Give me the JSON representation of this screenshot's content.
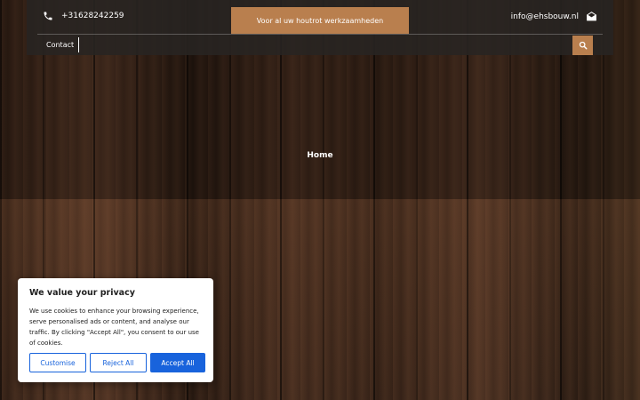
{
  "header": {
    "phone": "+31628242259",
    "tagline": "Voor al uw houtrot werkzaamheden",
    "email": "info@ehsbouw.nl",
    "nav": {
      "contact_label": "Contact"
    },
    "icons": {
      "phone": "phone-icon",
      "email": "envelope-icon",
      "search": "search-icon"
    },
    "accent_color": "#b97f4e"
  },
  "hero": {
    "breadcrumb": "Home"
  },
  "cookie_banner": {
    "title": "We value your privacy",
    "text": "We use cookies to enhance your browsing experience, serve personalised ads or content, and analyse our traffic. By clicking \"Accept All\", you consent to our use of cookies.",
    "customise_label": "Customise",
    "reject_label": "Reject All",
    "accept_label": "Accept All",
    "button_color": "#1863dc"
  }
}
